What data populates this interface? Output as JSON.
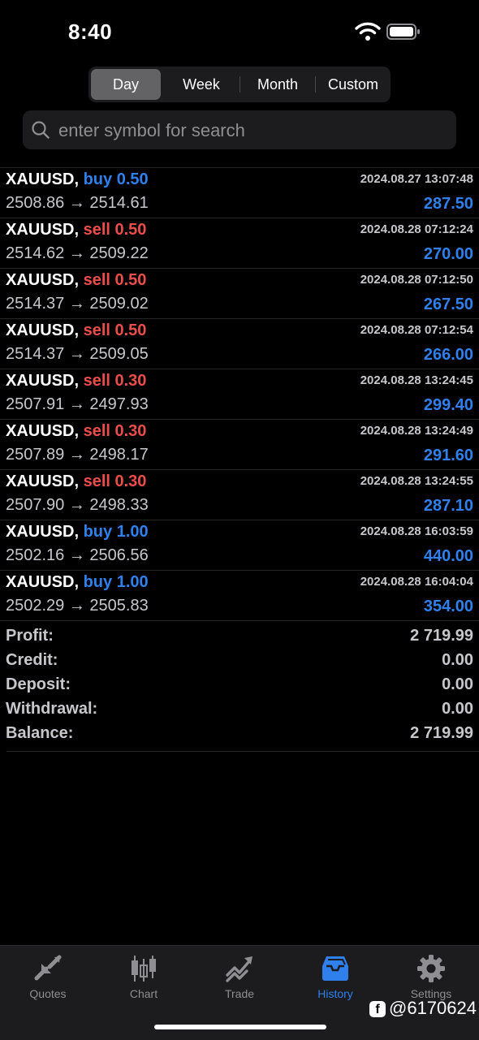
{
  "status_bar": {
    "time": "8:40"
  },
  "period_tabs": {
    "items": [
      "Day",
      "Week",
      "Month",
      "Custom"
    ],
    "active": "Day"
  },
  "search": {
    "placeholder": "enter symbol for search",
    "value": ""
  },
  "trades": [
    {
      "symbol": "XAUUSD,",
      "side": "buy",
      "volume": "0.50",
      "open": "2508.86",
      "close": "2514.61",
      "time": "2024.08.27 13:07:48",
      "profit": "287.50"
    },
    {
      "symbol": "XAUUSD,",
      "side": "sell",
      "volume": "0.50",
      "open": "2514.62",
      "close": "2509.22",
      "time": "2024.08.28 07:12:24",
      "profit": "270.00"
    },
    {
      "symbol": "XAUUSD,",
      "side": "sell",
      "volume": "0.50",
      "open": "2514.37",
      "close": "2509.02",
      "time": "2024.08.28 07:12:50",
      "profit": "267.50"
    },
    {
      "symbol": "XAUUSD,",
      "side": "sell",
      "volume": "0.50",
      "open": "2514.37",
      "close": "2509.05",
      "time": "2024.08.28 07:12:54",
      "profit": "266.00"
    },
    {
      "symbol": "XAUUSD,",
      "side": "sell",
      "volume": "0.30",
      "open": "2507.91",
      "close": "2497.93",
      "time": "2024.08.28 13:24:45",
      "profit": "299.40"
    },
    {
      "symbol": "XAUUSD,",
      "side": "sell",
      "volume": "0.30",
      "open": "2507.89",
      "close": "2498.17",
      "time": "2024.08.28 13:24:49",
      "profit": "291.60"
    },
    {
      "symbol": "XAUUSD,",
      "side": "sell",
      "volume": "0.30",
      "open": "2507.90",
      "close": "2498.33",
      "time": "2024.08.28 13:24:55",
      "profit": "287.10"
    },
    {
      "symbol": "XAUUSD,",
      "side": "buy",
      "volume": "1.00",
      "open": "2502.16",
      "close": "2506.56",
      "time": "2024.08.28 16:03:59",
      "profit": "440.00"
    },
    {
      "symbol": "XAUUSD,",
      "side": "buy",
      "volume": "1.00",
      "open": "2502.29",
      "close": "2505.83",
      "time": "2024.08.28 16:04:04",
      "profit": "354.00"
    }
  ],
  "summary": [
    {
      "label": "Profit:",
      "value": "2 719.99"
    },
    {
      "label": "Credit:",
      "value": "0.00"
    },
    {
      "label": "Deposit:",
      "value": "0.00"
    },
    {
      "label": "Withdrawal:",
      "value": "0.00"
    },
    {
      "label": "Balance:",
      "value": "2 719.99"
    }
  ],
  "tab_bar": [
    {
      "label": "Quotes",
      "icon": "quotes-icon"
    },
    {
      "label": "Chart",
      "icon": "chart-icon"
    },
    {
      "label": "Trade",
      "icon": "trade-icon"
    },
    {
      "label": "History",
      "icon": "history-icon",
      "active": true
    },
    {
      "label": "Settings",
      "icon": "settings-icon"
    }
  ],
  "watermark": {
    "text": "@6170624"
  },
  "colors": {
    "buy": "#2f80ed",
    "sell": "#eb4d4b",
    "accent": "#2f80ed",
    "background": "#000000"
  }
}
